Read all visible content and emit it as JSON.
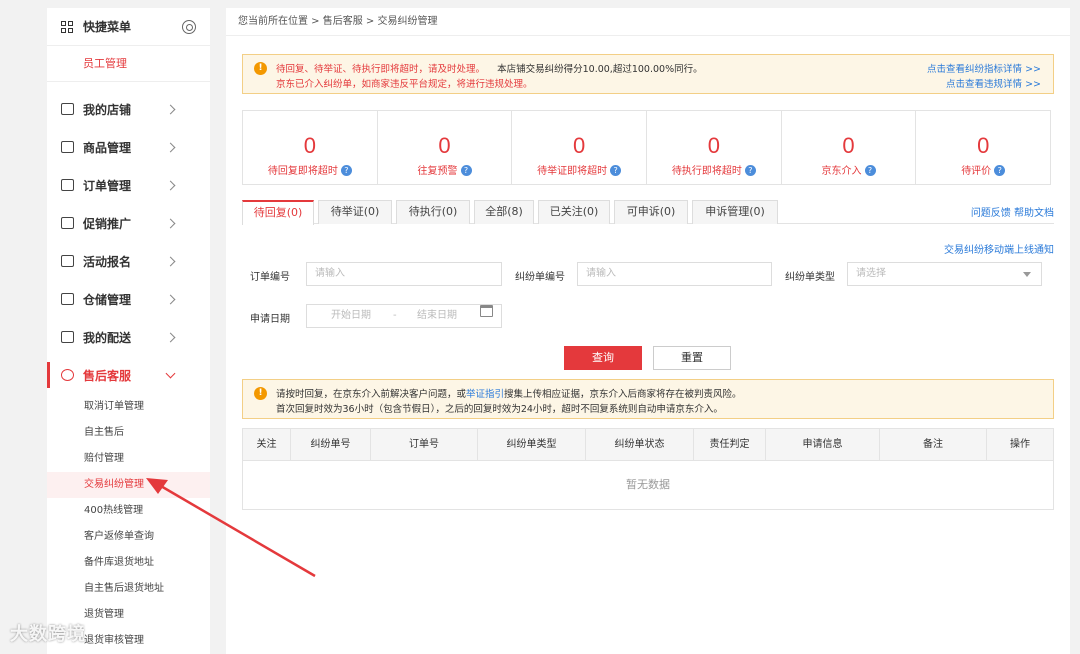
{
  "sidebar": {
    "quick_menu_title": "快捷菜单",
    "quick_items": [
      "员工管理"
    ],
    "menu": [
      {
        "label": "我的店铺"
      },
      {
        "label": "商品管理"
      },
      {
        "label": "订单管理"
      },
      {
        "label": "促销推广"
      },
      {
        "label": "活动报名"
      },
      {
        "label": "仓储管理"
      },
      {
        "label": "我的配送"
      },
      {
        "label": "售后客服"
      }
    ],
    "sub_items": [
      "取消订单管理",
      "自主售后",
      "赔付管理",
      "交易纠纷管理",
      "400热线管理",
      "客户返修单查询",
      "备件库退货地址",
      "自主售后退货地址",
      "退货管理",
      "退货审核管理"
    ]
  },
  "breadcrumb": "您当前所在位置 > 售后客服 > 交易纠纷管理",
  "notice1": {
    "line1_red": "待回复、待举证、待执行即将超时，请及时处理。",
    "line1_dark": "本店铺交易纠纷得分10.00,超过100.00%同行。",
    "line2": "京东已介入纠纷单，如商家违反平台规定，将进行违规处理。",
    "link1": "点击查看纠纷指标详情 >>",
    "link2": "点击查看违规详情 >>"
  },
  "stats": [
    {
      "value": "0",
      "label": "待回复即将超时"
    },
    {
      "value": "0",
      "label": "往复预警"
    },
    {
      "value": "0",
      "label": "待举证即将超时"
    },
    {
      "value": "0",
      "label": "待执行即将超时"
    },
    {
      "value": "0",
      "label": "京东介入"
    },
    {
      "value": "0",
      "label": "待评价"
    }
  ],
  "tabs": [
    "待回复(0)",
    "待举证(0)",
    "待执行(0)",
    "全部(8)",
    "已关注(0)",
    "可申诉(0)",
    "申诉管理(0)"
  ],
  "tabs_right": "问题反馈 帮助文档",
  "mobile_link": "交易纠纷移动端上线通知",
  "form": {
    "order_no_label": "订单编号",
    "order_no_placeholder": "请输入",
    "dispute_no_label": "纠纷单编号",
    "dispute_no_placeholder": "请输入",
    "dispute_type_label": "纠纷单类型",
    "dispute_type_placeholder": "请选择",
    "date_label": "申请日期",
    "start_date": "开始日期",
    "date_sep": "-",
    "end_date": "结束日期",
    "query_button": "查询",
    "reset_button": "重置"
  },
  "notice2": {
    "line1_a": "请按时回复，在京东介入前解决客户问题，或",
    "line1_link": "举证指引",
    "line1_b": "搜集上传相应证据，京东介入后商家将存在被判责风险。",
    "line2": "首次回复时效为36小时（包含节假日），之后的回复时效为24小时，超时不回复系统则自动申请京东介入。"
  },
  "table": {
    "headers": [
      "关注",
      "纠纷单号",
      "订单号",
      "纠纷单类型",
      "纠纷单状态",
      "责任判定",
      "申请信息",
      "备注",
      "操作"
    ],
    "empty": "暂无数据"
  },
  "watermark": "大数跨境",
  "colors": {
    "accent": "#e4393c",
    "link": "#2a7ad9",
    "warn_bg": "#fdf6e6"
  }
}
